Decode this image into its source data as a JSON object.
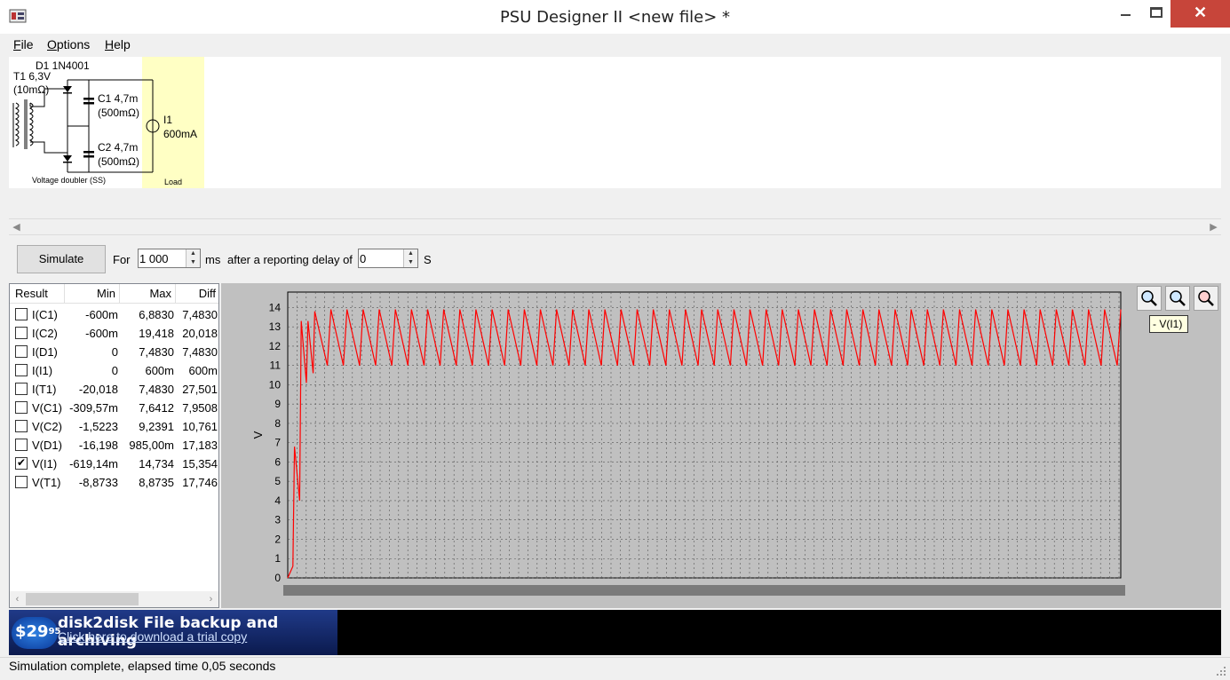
{
  "window": {
    "title": "PSU Designer II  <new file> *"
  },
  "menu": [
    "File",
    "Options",
    "Help"
  ],
  "schematic": {
    "diode_label": "D1 1N4001",
    "transformer_label": "T1 6,3V",
    "transformer_resistance": "(10mΩ)",
    "c1_label": "C1 4,7m",
    "c1_esr": "(500mΩ)",
    "c2_label": "C2 4,7m",
    "c2_esr": "(500mΩ)",
    "load_name": "I1",
    "load_value": "600mA",
    "section_label": "Voltage doubler (SS)",
    "load_section_label": "Load"
  },
  "simulation": {
    "button_label": "Simulate",
    "for_label": "For",
    "duration_value": "1 000",
    "duration_unit": "ms",
    "delay_label": "after a reporting delay of",
    "delay_value": "0",
    "delay_unit": "S"
  },
  "results": {
    "headers": {
      "result": "Result",
      "min": "Min",
      "max": "Max",
      "diff": "Diff"
    },
    "rows": [
      {
        "name": "I(C1)",
        "min": "-600m",
        "max": "6,8830",
        "diff": "7,4830",
        "checked": false
      },
      {
        "name": "I(C2)",
        "min": "-600m",
        "max": "19,418",
        "diff": "20,018",
        "checked": false
      },
      {
        "name": "I(D1)",
        "min": "0",
        "max": "7,4830",
        "diff": "7,4830",
        "checked": false
      },
      {
        "name": "I(I1)",
        "min": "0",
        "max": "600m",
        "diff": "600m",
        "checked": false
      },
      {
        "name": "I(T1)",
        "min": "-20,018",
        "max": "7,4830",
        "diff": "27,501",
        "checked": false
      },
      {
        "name": "V(C1)",
        "min": "-309,57m",
        "max": "7,6412",
        "diff": "7,9508",
        "checked": false
      },
      {
        "name": "V(C2)",
        "min": "-1,5223",
        "max": "9,2391",
        "diff": "10,761",
        "checked": false
      },
      {
        "name": "V(D1)",
        "min": "-16,198",
        "max": "985,00m",
        "diff": "17,183",
        "checked": false
      },
      {
        "name": "V(I1)",
        "min": "-619,14m",
        "max": "14,734",
        "diff": "15,354",
        "checked": true
      },
      {
        "name": "V(T1)",
        "min": "-8,8733",
        "max": "8,8735",
        "diff": "17,746",
        "checked": false
      }
    ]
  },
  "chart_data": {
    "type": "line",
    "ylabel": "V",
    "ylim": [
      0,
      14.8
    ],
    "y_ticks": [
      0,
      1,
      2,
      3,
      4,
      5,
      6,
      7,
      8,
      9,
      10,
      11,
      12,
      13,
      14
    ],
    "grid": true,
    "legend": "top-right",
    "series": [
      {
        "name": "V(I1)",
        "color": "#ff0000",
        "startup_peaks": [
          6.8,
          13.3,
          13.3,
          13.8
        ],
        "startup_troughs": [
          4.0,
          10.1,
          10.6
        ],
        "steady_max": 13.9,
        "steady_min": 11.0,
        "cycles": 50
      }
    ],
    "background": "#c0c0c0"
  },
  "zoom_buttons": [
    "zoom-in-icon",
    "zoom-out-icon",
    "zoom-reset-icon"
  ],
  "legend_label": "- V(I1)",
  "banner": {
    "price": "$29",
    "price_cents": "95",
    "title": "disk2disk File backup and archiving",
    "link": "Click here to download a trial copy"
  },
  "status": "Simulation complete, elapsed time 0,05 seconds"
}
